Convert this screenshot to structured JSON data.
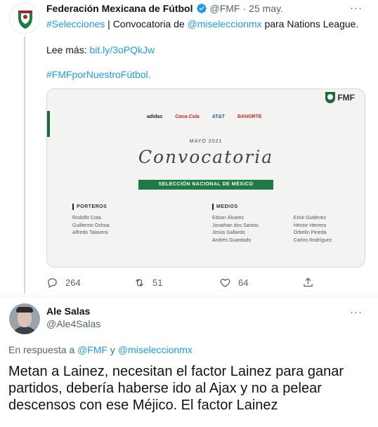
{
  "tweet1": {
    "author_name": "Federación Mexicana de Fútbol",
    "handle": "@FMF",
    "separator": "·",
    "date": "25 may.",
    "more_label": "···",
    "text": {
      "hashtag_selecciones": "#Selecciones",
      "segment_1": " | Convocatoria de ",
      "mention": "@miseleccionmx",
      "segment_2": " para Nations League.",
      "lee_mas": "Lee más: ",
      "short_link": "bit.ly/3oPQkJw",
      "hashtag_footer": "#FMFporNuestroFútbol."
    },
    "media": {
      "logo_text": "FMF",
      "sponsors": [
        "adidas",
        "Coca-Cola",
        "AT&T",
        "BANORTE"
      ],
      "date_label": "MAYO 2021",
      "title": "Convocatoria",
      "banner": "SELECCIÓN NACIONAL DE MÉXICO",
      "porteros": {
        "title": "PORTEROS",
        "players": [
          "Rodolfo Cota",
          "Guillermo Ochoa",
          "Alfredo Talavera"
        ]
      },
      "medios": {
        "title": "MEDIOS",
        "players_col1": [
          "Edson Álvarez",
          "Jonathan dos Santos",
          "Jesús Gallardo",
          "Andrés Guardado"
        ],
        "players_col2": [
          "Erick Gutiérrez",
          "Héctor Herrera",
          "Orbelín Pineda",
          "Carlos Rodríguez"
        ]
      }
    },
    "actions": {
      "replies": "264",
      "retweets": "51",
      "likes": "64"
    }
  },
  "tweet2": {
    "author_name": "Ale Salas",
    "handle": "@Ale4Salas",
    "more_label": "···",
    "reply_prefix": "En respuesta a ",
    "reply_mention_1": "@FMF",
    "reply_and": " y ",
    "reply_mention_2": "@miseleccionmx",
    "text": "Metan a Lainez, necesitan el factor Lainez para ganar partidos, debería haberse ido al Ajax y no a pelear descensos con ese Méjico. El factor Lainez"
  },
  "colors": {
    "link": "#1d9bf0",
    "secondary_text": "#536471",
    "fmf_green": "#1e7b43"
  }
}
